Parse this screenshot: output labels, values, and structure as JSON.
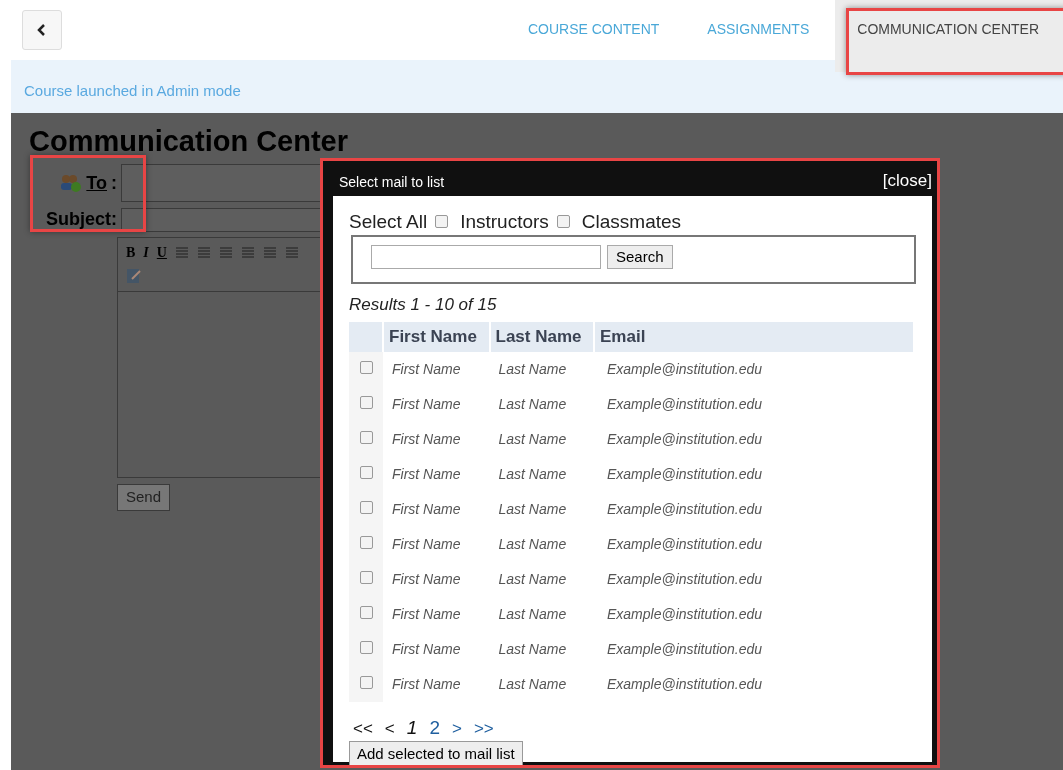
{
  "nav": {
    "tabs": [
      {
        "label": "COURSE CONTENT",
        "selected": false
      },
      {
        "label": "ASSIGNMENTS",
        "selected": false
      },
      {
        "label": "COMMUNICATION CENTER",
        "selected": true
      }
    ]
  },
  "banner": "Course launched in Admin mode",
  "page": {
    "title": "Communication Center",
    "to_label": "To",
    "to_colon": ":",
    "subject_label": "Subject:",
    "toolbar": [
      "B",
      "I",
      "U"
    ],
    "send": "Send"
  },
  "dialog": {
    "title": "Select mail to list",
    "close": "[close]",
    "select_all": "Select All",
    "filters": [
      {
        "label": "Instructors",
        "checked": false
      },
      {
        "label": "Classmates",
        "checked": false
      }
    ],
    "search_button": "Search",
    "results": "Results 1 - 10 of 15",
    "columns": [
      "First Name",
      "Last Name",
      "Email"
    ],
    "rows": [
      {
        "first": "First Name",
        "last": "Last Name",
        "email": "Example@institution.edu",
        "checked": false
      },
      {
        "first": "First Name",
        "last": "Last Name",
        "email": "Example@institution.edu",
        "checked": false
      },
      {
        "first": "First Name",
        "last": "Last Name",
        "email": "Example@institution.edu",
        "checked": false
      },
      {
        "first": "First Name",
        "last": "Last Name",
        "email": "Example@institution.edu",
        "checked": false
      },
      {
        "first": "First Name",
        "last": "Last Name",
        "email": "Example@institution.edu",
        "checked": false
      },
      {
        "first": "First Name",
        "last": "Last Name",
        "email": "Example@institution.edu",
        "checked": false
      },
      {
        "first": "First Name",
        "last": "Last Name",
        "email": "Example@institution.edu",
        "checked": false
      },
      {
        "first": "First Name",
        "last": "Last Name",
        "email": "Example@institution.edu",
        "checked": false
      },
      {
        "first": "First Name",
        "last": "Last Name",
        "email": "Example@institution.edu",
        "checked": false
      },
      {
        "first": "First Name",
        "last": "Last Name",
        "email": "Example@institution.edu",
        "checked": false
      }
    ],
    "pager": [
      {
        "label": "<<",
        "kind": "nav",
        "enabled": false
      },
      {
        "label": "<",
        "kind": "nav",
        "enabled": false
      },
      {
        "label": "1",
        "kind": "page",
        "selected": true
      },
      {
        "label": "2",
        "kind": "page",
        "selected": false
      },
      {
        "label": ">",
        "kind": "nav",
        "enabled": true
      },
      {
        "label": ">>",
        "kind": "nav",
        "enabled": true
      }
    ],
    "add_button": "Add selected to mail list"
  }
}
